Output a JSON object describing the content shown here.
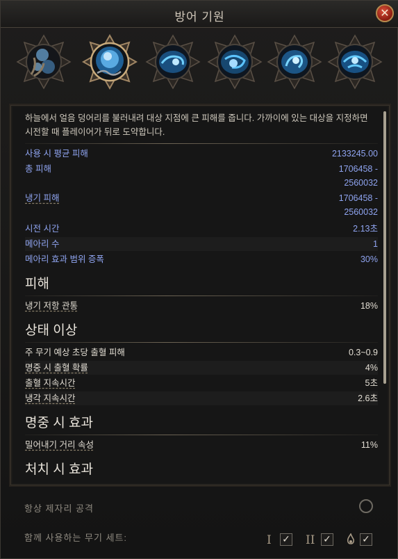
{
  "window": {
    "title": "방어 기원",
    "close_symbol": "✕"
  },
  "runes": [
    {
      "icon": "chained-orb-icon",
      "selected": false
    },
    {
      "icon": "ice-orb-selected-icon",
      "selected": true
    },
    {
      "icon": "ice-rune-variant-1-icon",
      "selected": false
    },
    {
      "icon": "ice-rune-variant-2-icon",
      "selected": false
    },
    {
      "icon": "ice-rune-variant-3-icon",
      "selected": false
    },
    {
      "icon": "ice-rune-variant-4-icon",
      "selected": false
    }
  ],
  "description": "하늘에서 얼음 덩어리를 불러내려 대상 지점에 큰 피해를 줍니다. 가까이에 있는 대상을 지정하면 시전할 때 플레이어가 뒤로 도약합니다.",
  "stats": [
    {
      "label": "사용 시 평균 피해",
      "value": "2133245.00"
    },
    {
      "label": "총 피해",
      "value": "1706458 -\n2560032"
    },
    {
      "label": "냉기 피해",
      "value": "1706458 -\n2560032"
    },
    {
      "label": "시전 시간",
      "value": "2.13초"
    },
    {
      "label": "메아리 수",
      "value": "1"
    },
    {
      "label": "메아리 효과 범위 증폭",
      "value": "30%"
    }
  ],
  "sections": [
    {
      "heading": "피해",
      "rows": [
        {
          "label": "냉기 저항 관통",
          "value": "18%"
        }
      ]
    },
    {
      "heading": "상태 이상",
      "rows": [
        {
          "label": "주 무기 예상 초당 출혈 피해",
          "value": "0.3~0.9"
        },
        {
          "label": "명중 시 출혈 확률",
          "value": "4%"
        },
        {
          "label": "출혈 지속시간",
          "value": "5초"
        },
        {
          "label": "냉각 지속시간",
          "value": "2.6초"
        }
      ]
    },
    {
      "heading": "명중 시 효과",
      "rows": [
        {
          "label": "밀어내기 거리 속성",
          "value": "11%"
        }
      ]
    },
    {
      "heading": "처치 시 효과",
      "rows": []
    }
  ],
  "footer": {
    "always_attack_label": "항상 제자리 공격",
    "weapon_set_label": "함께 사용하는 무기 세트:",
    "set_1_label": "I",
    "set_2_label": "II",
    "check_symbol": "✓"
  },
  "colors": {
    "stat_blue": "#8fa4f0",
    "heading_text": "#e8e3da",
    "close_red": "#b3301f",
    "rune_glow": "#3fb6ff"
  }
}
